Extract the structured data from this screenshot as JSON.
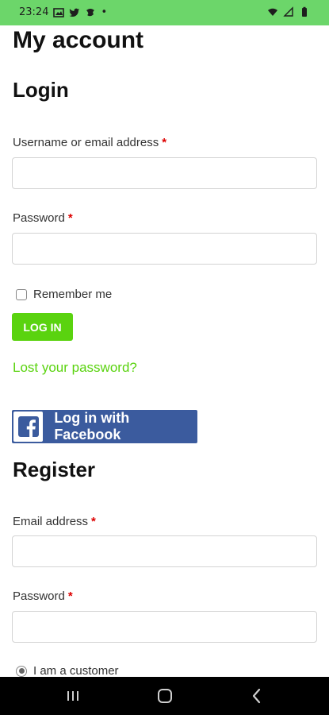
{
  "status_bar": {
    "time": "23:24",
    "dot": "•"
  },
  "page": {
    "title": "My account"
  },
  "login": {
    "heading": "Login",
    "username_label": "Username or email address",
    "required_mark": "*",
    "username_value": "",
    "password_label": "Password",
    "password_value": "",
    "remember_label": "Remember me",
    "login_button": "LOG IN",
    "lost_password": "Lost your password?",
    "facebook_button": "Log in with Facebook"
  },
  "register": {
    "heading": "Register",
    "email_label": "Email address",
    "email_value": "",
    "password_label": "Password",
    "password_value": "",
    "customer_radio_label": "I am a customer"
  },
  "colors": {
    "status_bar": "#6cd66a",
    "accent_green": "#5ad30f",
    "facebook_blue": "#3b5b9e",
    "required_red": "#dd0000"
  },
  "icons": {
    "status_left": [
      "gallery-icon",
      "twitter-icon",
      "app-icon"
    ],
    "status_right": [
      "wifi-icon",
      "signal-icon",
      "battery-icon"
    ],
    "nav": [
      "recent-apps-icon",
      "home-icon",
      "back-icon"
    ]
  }
}
